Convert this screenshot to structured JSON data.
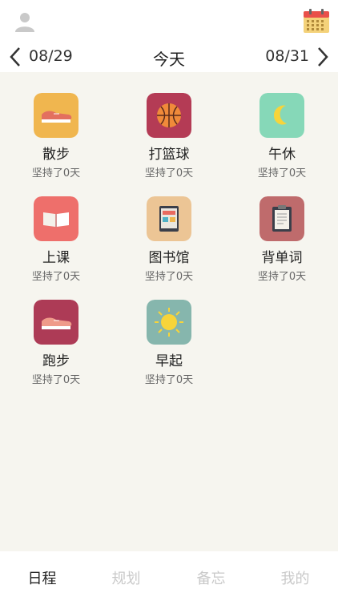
{
  "header": {
    "prev_date": "08/29",
    "today_label": "今天",
    "next_date": "08/31"
  },
  "habits": [
    {
      "name": "散步",
      "streak": "坚持了0天",
      "icon": "sneaker-icon",
      "color": "#f0b64f"
    },
    {
      "name": "打篮球",
      "streak": "坚持了0天",
      "icon": "basketball-icon",
      "color": "#b43b55"
    },
    {
      "name": "午休",
      "streak": "坚持了0天",
      "icon": "moon-icon",
      "color": "#86d8b8"
    },
    {
      "name": "上课",
      "streak": "坚持了0天",
      "icon": "book-icon",
      "color": "#ee6f6b"
    },
    {
      "name": "图书馆",
      "streak": "坚持了0天",
      "icon": "tablet-icon",
      "color": "#ecc595"
    },
    {
      "name": "背单词",
      "streak": "坚持了0天",
      "icon": "clipboard-icon",
      "color": "#bf6b6c"
    },
    {
      "name": "跑步",
      "streak": "坚持了0天",
      "icon": "sneaker-icon",
      "color": "#ad3b56"
    },
    {
      "name": "早起",
      "streak": "坚持了0天",
      "icon": "sun-icon",
      "color": "#86b6ad"
    }
  ],
  "tabs": [
    {
      "label": "日程",
      "active": true
    },
    {
      "label": "规划",
      "active": false
    },
    {
      "label": "备忘",
      "active": false
    },
    {
      "label": "我的",
      "active": false
    }
  ]
}
